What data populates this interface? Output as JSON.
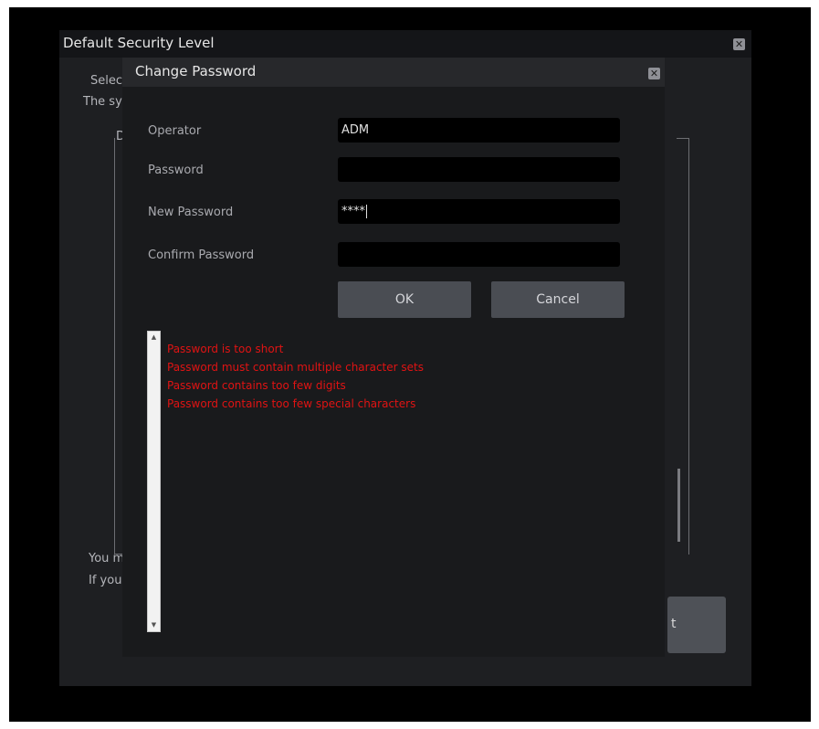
{
  "background_dialog": {
    "title": "Default Security Level",
    "select_text": "Select",
    "system_text": "The sys",
    "group_label": "D",
    "you_text": "You ma",
    "if_text": "If you c",
    "button_label": "t"
  },
  "change_password": {
    "title": "Change Password",
    "labels": {
      "operator": "Operator",
      "password": "Password",
      "new_password": "New Password",
      "confirm_password": "Confirm Password"
    },
    "values": {
      "operator": "ADM",
      "password": "",
      "new_password": "****",
      "confirm_password": ""
    },
    "ok_label": "OK",
    "cancel_label": "Cancel",
    "messages": [
      "Password is too short",
      "Password must contain multiple character sets",
      "Password contains too few digits",
      "Password contains too few special characters"
    ]
  },
  "colors": {
    "error_text": "#e01313",
    "dialog_bg": "#191a1c",
    "field_bg": "#000000"
  },
  "icons": {
    "close": "close-icon",
    "scroll_up": "scroll-up-arrow-icon",
    "scroll_down": "scroll-down-arrow-icon"
  }
}
